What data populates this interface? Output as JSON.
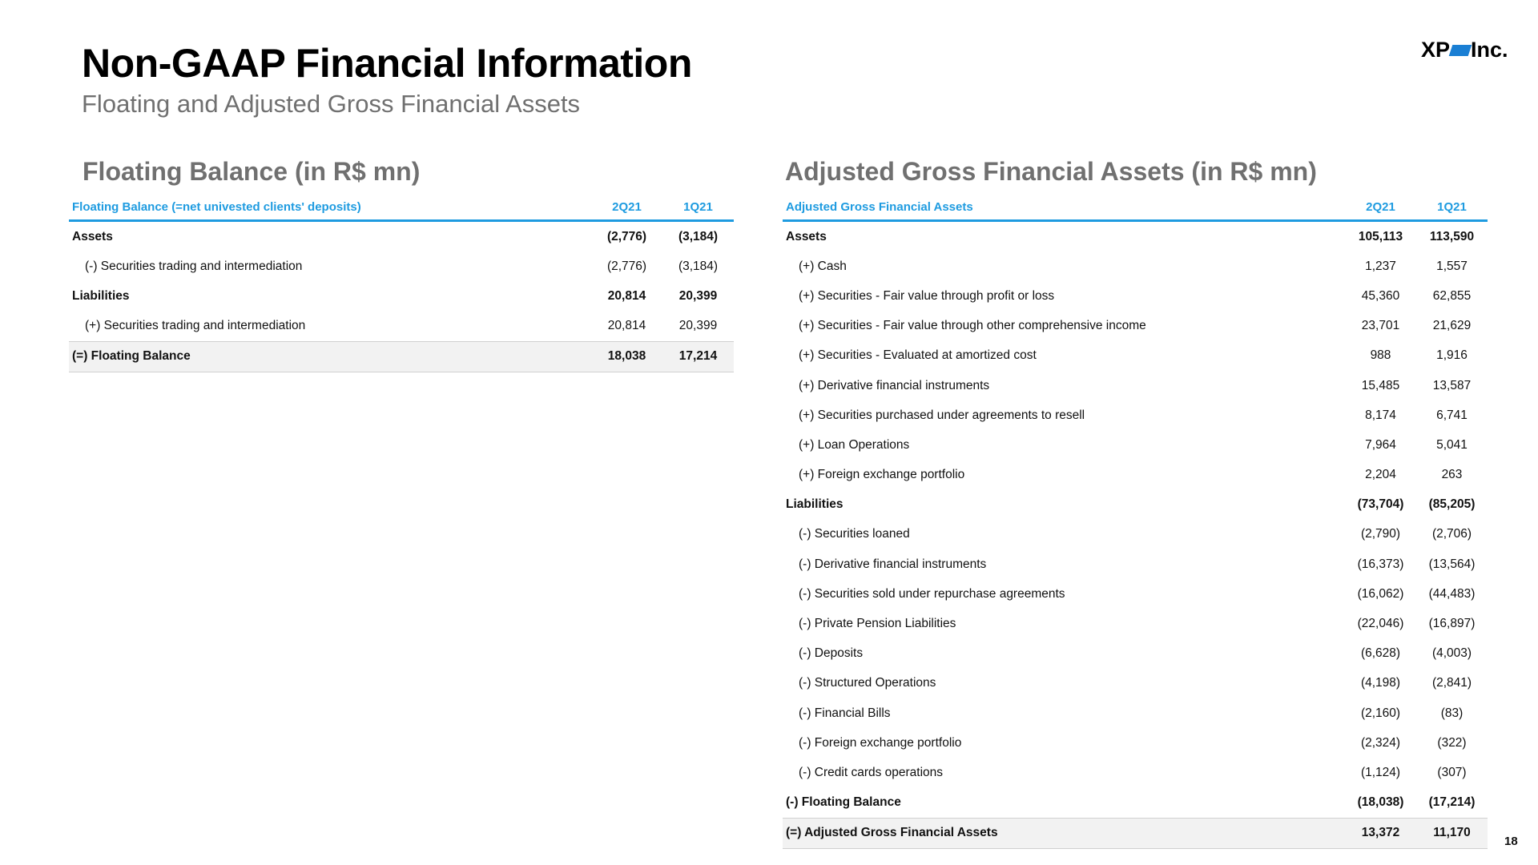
{
  "header": {
    "title": "Non-GAAP Financial Information",
    "subtitle": "Floating and Adjusted Gross Financial Assets",
    "logo_left": "XP",
    "logo_right": "Inc."
  },
  "floating": {
    "section_title": "Floating Balance (in R$ mn)",
    "header_label": "Floating Balance (=net univested clients' deposits)",
    "col1": "2Q21",
    "col2": "1Q21",
    "rows": [
      {
        "label": "Assets",
        "v1": "(2,776)",
        "v2": "(3,184)"
      },
      {
        "label": "(-) Securities trading and intermediation",
        "v1": "(2,776)",
        "v2": "(3,184)"
      },
      {
        "label": "Liabilities",
        "v1": "20,814",
        "v2": "20,399"
      },
      {
        "label": "(+) Securities trading and intermediation",
        "v1": "20,814",
        "v2": "20,399"
      },
      {
        "label": "(=) Floating Balance",
        "v1": "18,038",
        "v2": "17,214"
      }
    ]
  },
  "adjusted": {
    "section_title": "Adjusted Gross Financial Assets (in R$ mn)",
    "header_label": "Adjusted Gross Financial Assets",
    "col1": "2Q21",
    "col2": "1Q21",
    "rows": [
      {
        "label": "Assets",
        "v1": "105,113",
        "v2": "113,590"
      },
      {
        "label": "(+) Cash",
        "v1": "1,237",
        "v2": "1,557"
      },
      {
        "label": "(+) Securities - Fair value through profit or loss",
        "v1": "45,360",
        "v2": "62,855"
      },
      {
        "label": "(+) Securities - Fair value through other comprehensive income",
        "v1": "23,701",
        "v2": "21,629"
      },
      {
        "label": "(+) Securities - Evaluated at amortized cost",
        "v1": "988",
        "v2": "1,916"
      },
      {
        "label": "(+) Derivative financial instruments",
        "v1": "15,485",
        "v2": "13,587"
      },
      {
        "label": "(+) Securities purchased under agreements to resell",
        "v1": "8,174",
        "v2": "6,741"
      },
      {
        "label": "(+) Loan Operations",
        "v1": "7,964",
        "v2": "5,041"
      },
      {
        "label": "(+) Foreign exchange portfolio",
        "v1": "2,204",
        "v2": "263"
      },
      {
        "label": "Liabilities",
        "v1": "(73,704)",
        "v2": "(85,205)"
      },
      {
        "label": "(-) Securities loaned",
        "v1": "(2,790)",
        "v2": "(2,706)"
      },
      {
        "label": "(-) Derivative financial instruments",
        "v1": "(16,373)",
        "v2": "(13,564)"
      },
      {
        "label": "(-) Securities sold under repurchase agreements",
        "v1": "(16,062)",
        "v2": "(44,483)"
      },
      {
        "label": "(-) Private Pension Liabilities",
        "v1": "(22,046)",
        "v2": "(16,897)"
      },
      {
        "label": "(-) Deposits",
        "v1": "(6,628)",
        "v2": "(4,003)"
      },
      {
        "label": "(-) Structured Operations",
        "v1": "(4,198)",
        "v2": "(2,841)"
      },
      {
        "label": "(-) Financial Bills",
        "v1": "(2,160)",
        "v2": "(83)"
      },
      {
        "label": "(-) Foreign exchange portfolio",
        "v1": "(2,324)",
        "v2": "(322)"
      },
      {
        "label": "(-) Credit cards operations",
        "v1": "(1,124)",
        "v2": "(307)"
      },
      {
        "label": "(-) Floating Balance",
        "v1": "(18,038)",
        "v2": "(17,214)"
      },
      {
        "label": "(=) Adjusted Gross Financial Assets",
        "v1": "13,372",
        "v2": "11,170"
      }
    ]
  },
  "footer": {
    "page_number": "18"
  },
  "colors": {
    "accent": "#1e9be0",
    "logo_mark": "#1a7fd4",
    "subtitle_gray": "#707070"
  }
}
